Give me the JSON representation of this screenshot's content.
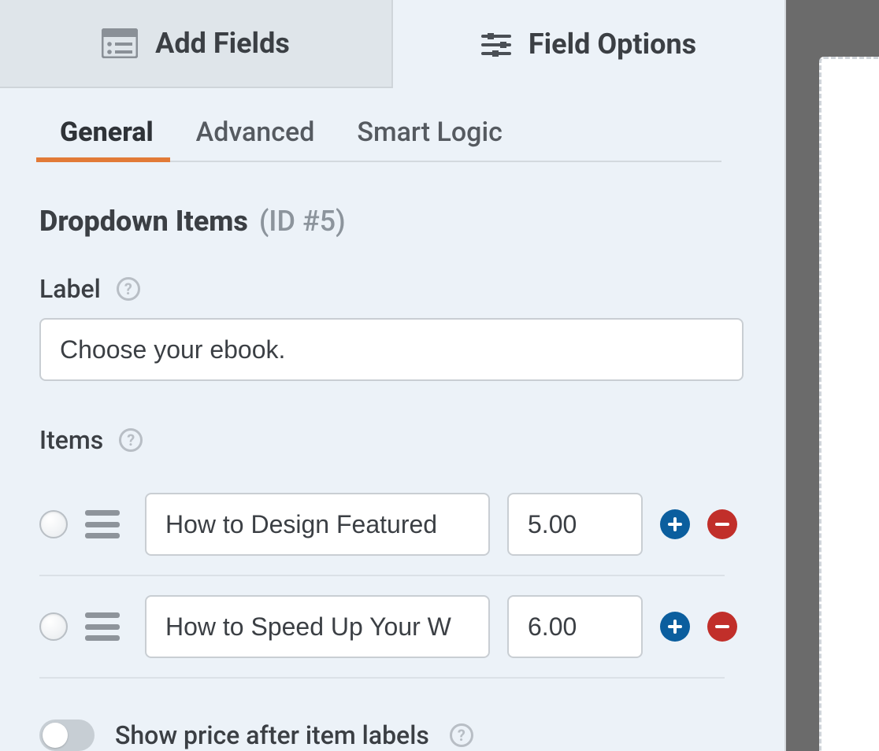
{
  "topbar": {
    "add_fields": "Add Fields",
    "field_options": "Field Options"
  },
  "subtabs": {
    "general": "General",
    "advanced": "Advanced",
    "smart_logic": "Smart Logic"
  },
  "field": {
    "title": "Dropdown Items",
    "id_text": "(ID #5)",
    "label_heading": "Label",
    "label_value": "Choose your ebook.",
    "items_heading": "Items",
    "items": [
      {
        "name": "How to Design Featured",
        "price": "5.00"
      },
      {
        "name": "How to Speed Up Your W",
        "price": "6.00"
      }
    ],
    "toggle_label": "Show price after item labels"
  }
}
